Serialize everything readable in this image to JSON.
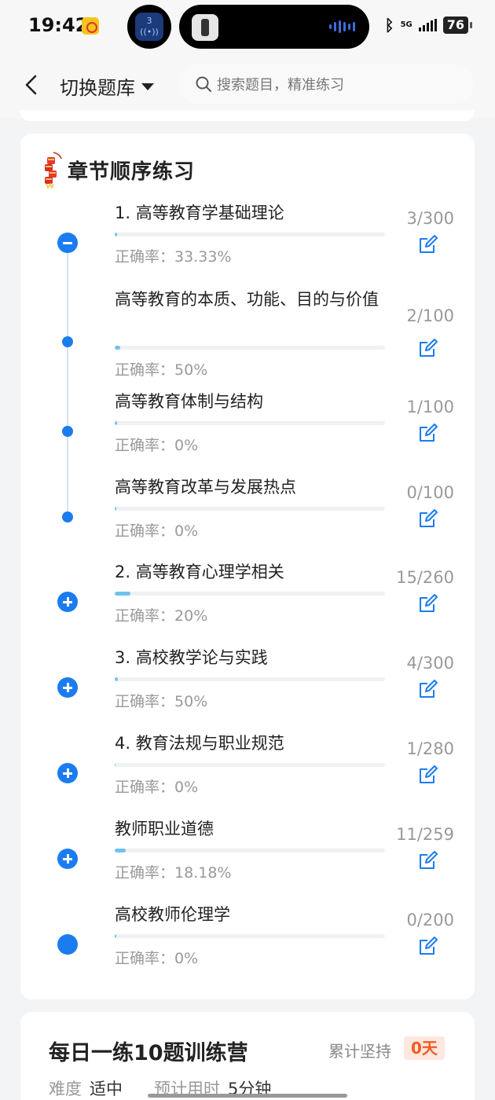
{
  "status_bar": {
    "time": "19:42",
    "bubble_badge": "3",
    "network": "5G",
    "battery": "76"
  },
  "header": {
    "back_icon": "chevron-left-icon",
    "switch_label": "切换题库",
    "search_placeholder": "搜索题目，精准练习"
  },
  "section": {
    "title": "章节顺序练习",
    "accuracy_label": "正确率：",
    "chapters": [
      {
        "title": "1. 高等教育学基础理论",
        "count": "3/300",
        "accuracy": "33.33%",
        "progress": 0.01,
        "node": "collapse"
      },
      {
        "title": "高等教育的本质、功能、目的与价值",
        "count": "2/100",
        "accuracy": "50%",
        "progress": 0.02,
        "node": "dot"
      },
      {
        "title": "高等教育体制与结构",
        "count": "1/100",
        "accuracy": "0%",
        "progress": 0.01,
        "node": "dot"
      },
      {
        "title": "高等教育改革与发展热点",
        "count": "0/100",
        "accuracy": "0%",
        "progress": 0.0,
        "node": "dot"
      },
      {
        "title": "2. 高等教育心理学相关",
        "count": "15/260",
        "accuracy": "20%",
        "progress": 0.058,
        "node": "expand"
      },
      {
        "title": "3. 高校教学论与实践",
        "count": "4/300",
        "accuracy": "50%",
        "progress": 0.013,
        "node": "expand"
      },
      {
        "title": "4. 教育法规与职业规范",
        "count": "1/280",
        "accuracy": "0%",
        "progress": 0.004,
        "node": "expand"
      },
      {
        "title": "教师职业道德",
        "count": "11/259",
        "accuracy": "18.18%",
        "progress": 0.042,
        "node": "expand"
      },
      {
        "title": "高校教师伦理学",
        "count": "0/200",
        "accuracy": "0%",
        "progress": 0.0,
        "node": "big"
      }
    ]
  },
  "daily": {
    "title": "每日一练10题训练营",
    "streak_label": "累计坚持",
    "streak_value": "0天",
    "difficulty_label": "难度",
    "difficulty_value": "适中",
    "time_label": "预计用时",
    "time_value": "5分钟"
  },
  "colors": {
    "accent": "#1b7cf0",
    "progress": "#6fc1ee",
    "streak": "#f05a22"
  }
}
